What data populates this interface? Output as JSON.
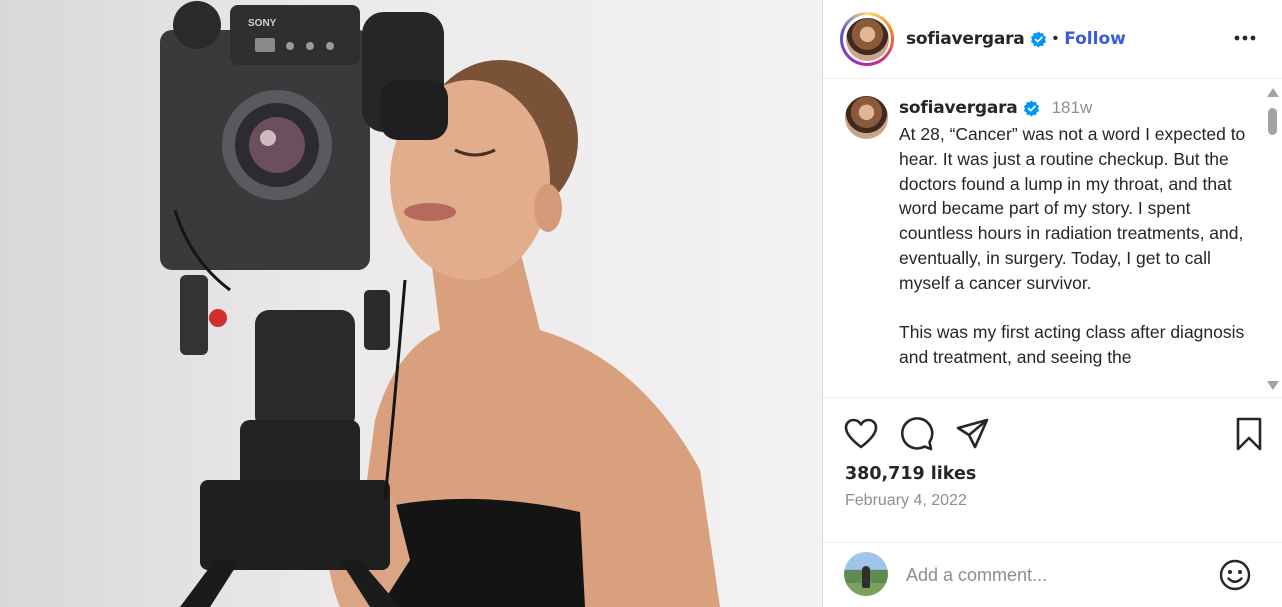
{
  "post": {
    "photo_alt": "Woman posing with a Sony professional video camera on a tripod, looking through the viewfinder",
    "camera_brand": "SONY"
  },
  "header": {
    "username": "sofiavergara",
    "separator": "•",
    "follow_label": "Follow",
    "more_icon": "more-options-icon"
  },
  "caption": {
    "username": "sofiavergara",
    "time": "181w",
    "text": "At 28, “Cancer” was not a word I expected to hear. It was just a routine checkup. But the doctors found a lump in my throat, and that word became part of my story. I spent countless hours in radiation treatments, and, eventually, in surgery. Today, I get to call myself a cancer survivor.\n\nThis was my first acting class after diagnosis and treatment, and seeing the"
  },
  "actions": {
    "icons": [
      "heart-icon",
      "comment-icon",
      "share-icon",
      "bookmark-icon"
    ]
  },
  "likes": "380,719 likes",
  "date": "February 4, 2022",
  "comment": {
    "placeholder": "Add a comment..."
  },
  "colors": {
    "follow": "#385adf",
    "verified": "#0095f6",
    "muted": "#8e8e8e",
    "text": "#262626"
  }
}
